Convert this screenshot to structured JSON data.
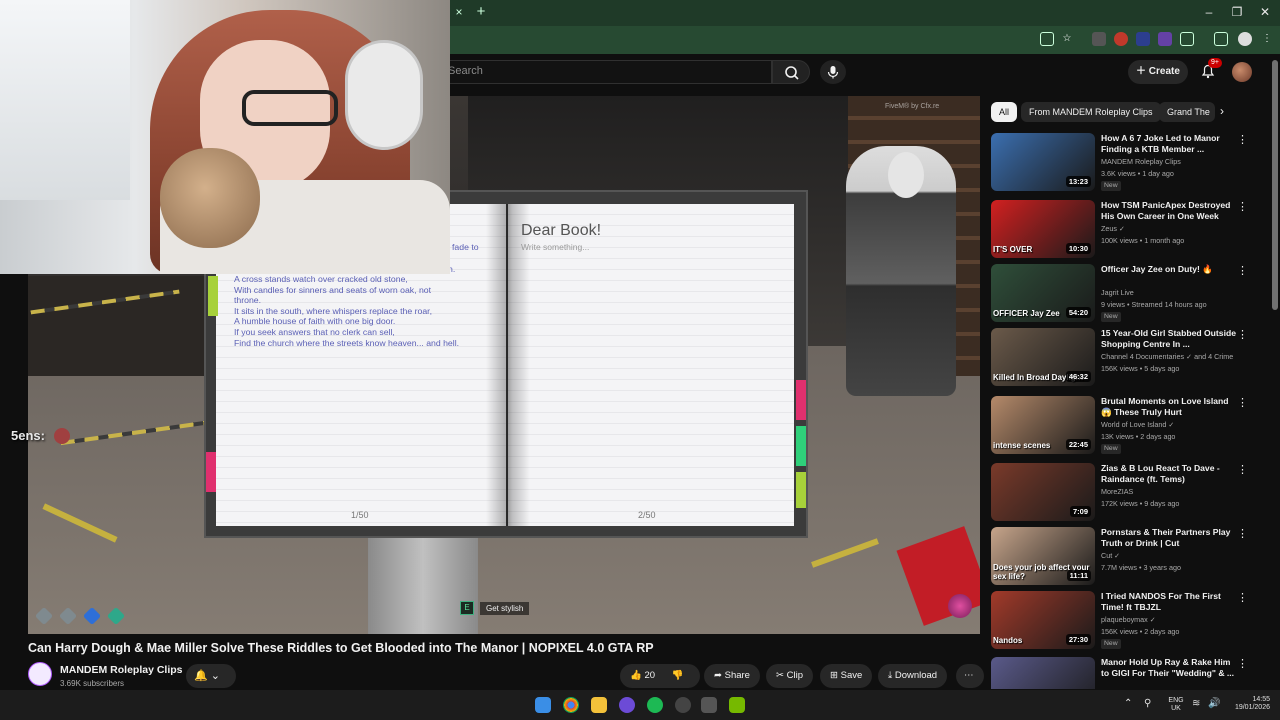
{
  "browser": {
    "tab_close": "×",
    "new_tab": "+",
    "win_min": "–",
    "win_max": "❐",
    "win_close": "✕"
  },
  "header": {
    "search_placeholder": "Search",
    "create_label": "Create",
    "notifications": "9+"
  },
  "player": {
    "chat_name": "5ens:",
    "watermark": "FiveM® by Cfx.re",
    "prompt_key": "E",
    "prompt_text": "Get stylish"
  },
  "book": {
    "left_fragment_1": "fade to",
    "left_fragment_2": "h.",
    "poem_lines": [
      "A cross stands watch over cracked old stone,",
      "With candles for sinners and seats of worn oak, not",
      "throne.",
      "It sits in the south, where whispers replace the roar,",
      "A humble house of faith with one big door.",
      "If you seek answers that no clerk can sell,",
      "Find the church where the streets know heaven... and hell."
    ],
    "right_title": "Dear Book!",
    "right_placeholder": "Write something...",
    "left_page_number": "1/50",
    "right_page_number": "2/50"
  },
  "video": {
    "title": "Can Harry Dough & Mae Miller Solve These Riddles to Get Blooded into The Manor | NOPIXEL 4.0 GTA RP",
    "channel_name": "MANDEM Roleplay Clips",
    "channel_subs": "3.69K subscribers",
    "likes": "20",
    "share_label": "Share",
    "clip_label": "Clip",
    "save_label": "Save",
    "download_label": "Download",
    "more_label": "⋯"
  },
  "chips": [
    {
      "label": "All"
    },
    {
      "label": "From MANDEM Roleplay Clips"
    },
    {
      "label": "Grand The"
    }
  ],
  "recommendations": [
    {
      "title": "How A 6 7 Joke Led to Manor Finding a KTB Member ...",
      "channel": "MANDEM Roleplay Clips",
      "meta": "3.6K views • 1 day ago",
      "badge": "New",
      "duration": "13:23",
      "thumb_color": "#3b6fb0",
      "overlay": ""
    },
    {
      "title": "How TSM PanicApex Destroyed His Own Career in One Week",
      "channel": "Zeus ✓",
      "meta": "100K views • 1 month ago",
      "badge": "",
      "duration": "10:30",
      "thumb_color": "#d22020",
      "overlay": "IT'S OVER"
    },
    {
      "title": "Officer Jay Zee on Duty! 🔥",
      "channel": "Jagrit Live",
      "meta": "9 views • Streamed 14 hours ago",
      "badge": "New",
      "duration": "54:20",
      "thumb_color": "#2f4f3a",
      "overlay": "OFFICER Jay Zee"
    },
    {
      "title": "15 Year-Old Girl Stabbed Outside Shopping Centre In ...",
      "channel": "Channel 4 Documentaries ✓ and 4 Crime",
      "meta": "156K views • 5 days ago",
      "badge": "",
      "duration": "46:32",
      "thumb_color": "#6b5a4a",
      "overlay": "Killed In Broad Daylight"
    },
    {
      "title": "Brutal Moments on Love Island 😱 These Truly Hurt",
      "channel": "World of Love Island ✓",
      "meta": "13K views • 2 days ago",
      "badge": "New",
      "duration": "22:45",
      "thumb_color": "#b58a6a",
      "overlay": "intense scenes"
    },
    {
      "title": "Zias & B Lou React To Dave - Raindance (ft. Tems)",
      "channel": "MoreZIAS",
      "meta": "172K views • 9 days ago",
      "badge": "",
      "duration": "7:09",
      "thumb_color": "#7a3a2a",
      "overlay": ""
    },
    {
      "title": "Pornstars & Their Partners Play Truth or Drink | Cut",
      "channel": "Cut ✓",
      "meta": "7.7M views • 3 years ago",
      "badge": "",
      "duration": "11:11",
      "thumb_color": "#c7a58b",
      "overlay": "Does your job affect your sex life?"
    },
    {
      "title": "I Tried NANDOS For The First Time! ft TBJZL",
      "channel": "plaqueboymax ✓",
      "meta": "156K views • 2 days ago",
      "badge": "New",
      "duration": "27:30",
      "thumb_color": "#a23a2a",
      "overlay": "Nandos"
    },
    {
      "title": "Manor Hold Up Ray & Rake Him to GIGI For Their \"Wedding\" & ...",
      "channel": "",
      "meta": "",
      "badge": "",
      "duration": "",
      "thumb_color": "#5a5a8a",
      "overlay": ""
    }
  ],
  "taskbar": {
    "lang_1": "ENG",
    "lang_2": "UK",
    "time": "14:55",
    "date": "19/01/2026"
  }
}
